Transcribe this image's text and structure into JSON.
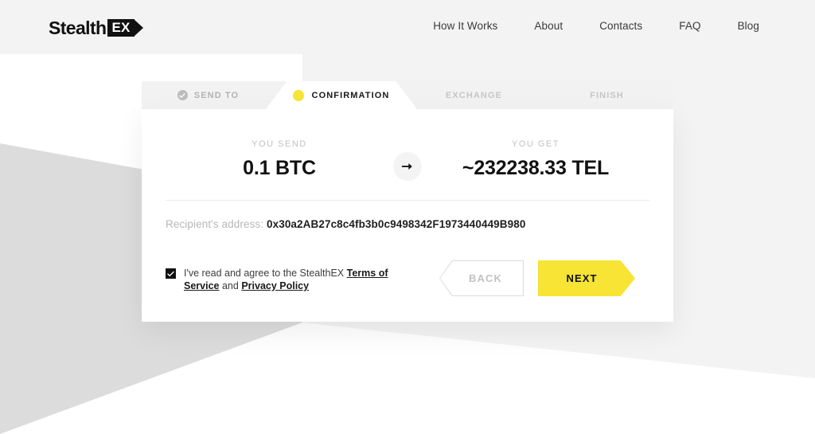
{
  "header": {
    "logo": {
      "word": "Stealth",
      "badge": "EX",
      "name": "StealthEX"
    },
    "nav": [
      {
        "label": "How It Works"
      },
      {
        "label": "About"
      },
      {
        "label": "Contacts"
      },
      {
        "label": "FAQ"
      },
      {
        "label": "Blog"
      }
    ]
  },
  "steps": [
    {
      "label": "SEND TO",
      "state": "done",
      "icon": "check-circle-icon"
    },
    {
      "label": "CONFIRMATION",
      "state": "active",
      "icon": "dot-icon"
    },
    {
      "label": "EXCHANGE",
      "state": "upcoming",
      "icon": ""
    },
    {
      "label": "FINISH",
      "state": "upcoming",
      "icon": ""
    }
  ],
  "exchange": {
    "send_label": "YOU SEND",
    "send_value": "0.1 BTC",
    "get_label": "YOU GET",
    "get_value": "~232238.33 TEL",
    "swap_icon": "arrow-right-icon"
  },
  "recipient": {
    "label": "Recipient's address:",
    "value": "0x30a2AB27c8c4fb3b0c9498342F1973440449B980"
  },
  "terms": {
    "checked": true,
    "text_before": "I've read and agree to the StealthEX",
    "link_terms": "Terms of Service",
    "text_and": "and",
    "link_privacy": "Privacy Policy"
  },
  "buttons": {
    "back": "BACK",
    "next": "NEXT"
  },
  "colors": {
    "accent_yellow": "#F7E434",
    "page_bg": "#FFFFFF",
    "band_gray": "#F2F2F2",
    "wedge_gray": "#DDDDDD",
    "text_dark": "#111111",
    "text_muted": "#C2C2C2"
  }
}
